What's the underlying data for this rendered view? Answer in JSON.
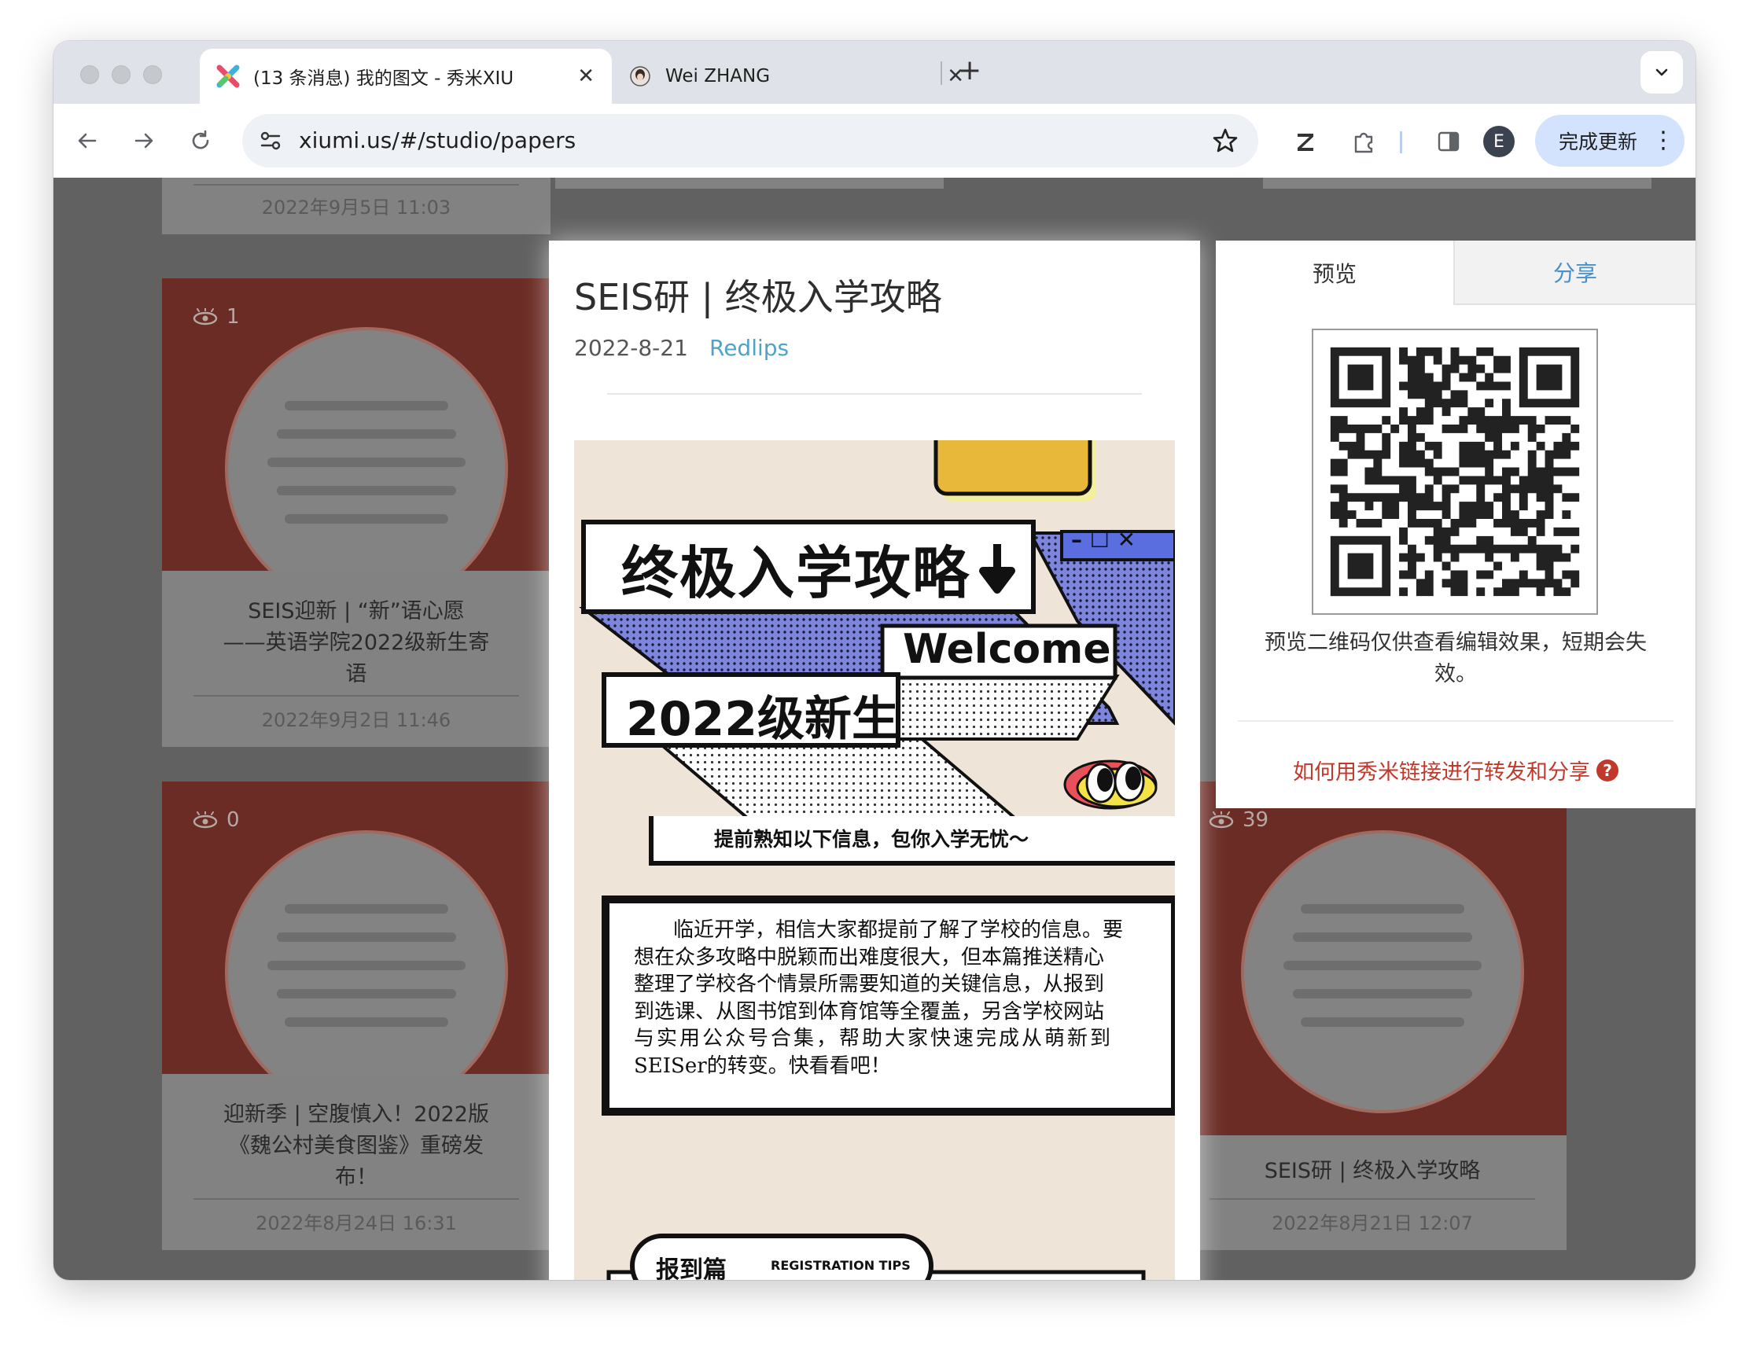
{
  "browser": {
    "tabs": [
      {
        "title": "(13 条消息) 我的图文 - 秀米XIU",
        "active": true,
        "favicon": "xiumi-icon"
      },
      {
        "title": "Wei ZHANG",
        "active": false,
        "favicon": "avatar-icon"
      }
    ],
    "new_tab_label": "+",
    "url": "xiumi.us/#/studio/papers",
    "profile_initial": "E",
    "update_button": "完成更新",
    "colors": {
      "omnibox": "#eef1f5",
      "update_button": "#d3e3fd",
      "tab_strip": "#dfe3e9"
    }
  },
  "cards": [
    {
      "id": "top-left",
      "title": "",
      "date": "2022年9月5日 11:03",
      "views": ""
    },
    {
      "id": "mid-left",
      "views": "1",
      "title_lines": [
        "SEIS迎新 | “新”语心愿",
        "——英语学院2022级新生寄",
        "语"
      ],
      "date": "2022年9月2日 11:46"
    },
    {
      "id": "bottom-left",
      "views": "0",
      "title_lines": [
        "迎新季 | 空腹慎入！2022版",
        "《魏公村美食图鉴》重磅发",
        "布！"
      ],
      "date": "2022年8月24日 16:31"
    },
    {
      "id": "bottom-right",
      "views": "39",
      "title_lines": [
        "SEIS研 | 终极入学攻略"
      ],
      "date": "2022年8月21日 12:07"
    }
  ],
  "preview": {
    "title": "SEIS研 | 终极入学攻略",
    "date": "2022-8-21",
    "author": "Redlips",
    "poster": {
      "headline": "终极入学攻略",
      "window_controls": "– ☐ ✕",
      "welcome": "Welcome",
      "class_label": "2022级新生",
      "subtitle": "提前熟知以下信息，包你入学无忧～",
      "intro_lines": [
        "临近开学，相信大家都提前了解了学校的信息。要",
        "想在众多攻略中脱颖而出难度很大，但本篇推送精心",
        "整理了学校各个情景所需要知道的关键信息，从报到",
        "到选课、从图书馆到体育馆等全覆盖，另含学校网站",
        "与实用公众号合集，帮助大家快速完成从萌新到",
        "SEISer的转变。快看看吧！"
      ],
      "section_cn": "报到篇",
      "section_en": "REGISTRATION TIPS",
      "colors": {
        "background": "#efe4d8",
        "accent_yellow": "#e8b83a",
        "accent_blue": "#7d86dc"
      }
    }
  },
  "share_panel": {
    "tabs": [
      "预览",
      "分享"
    ],
    "active_tab": "预览",
    "qr_note": "预览二维码仅供查看编辑效果，短期会失效。",
    "help_link": "如何用秀米链接进行转发和分享",
    "colors": {
      "link": "#c0392b",
      "tab_inactive": "#4a90c8"
    }
  }
}
